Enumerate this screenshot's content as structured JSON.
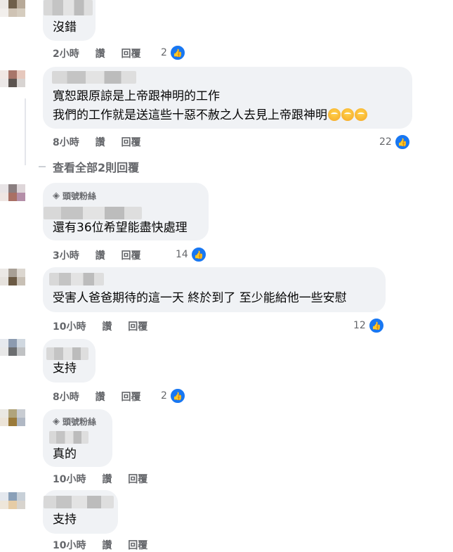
{
  "comments": [
    {
      "text": "沒錯",
      "time": "2小時",
      "like": "讚",
      "reply": "回覆",
      "reactions": "2"
    },
    {
      "text_line1": "寬恕跟原諒是上帝跟神明的工作",
      "text_line2": "我們的工作就是送這些十惡不赦之人去見上帝跟神明",
      "time": "8小時",
      "like": "讚",
      "reply": "回覆",
      "reactions": "22"
    },
    {
      "badge": "頭號粉絲",
      "text": "還有36位希望能盡快處理",
      "time": "3小時",
      "like": "讚",
      "reply": "回覆",
      "reactions": "14"
    },
    {
      "text": "受害人爸爸期待的這一天 終於到了 至少能給他一些安慰",
      "time": "10小時",
      "like": "讚",
      "reply": "回覆",
      "reactions": "12"
    },
    {
      "text": "支持",
      "time": "8小時",
      "like": "讚",
      "reply": "回覆",
      "reactions": "2"
    },
    {
      "badge": "頭號粉絲",
      "text": "真的",
      "time": "10小時",
      "like": "讚",
      "reply": "回覆"
    },
    {
      "text": "支持",
      "time": "10小時",
      "like": "讚",
      "reply": "回覆"
    }
  ],
  "view_all_replies": "查看全部2則回覆",
  "icons": {
    "like": "thumbs-up-icon",
    "fan_badge": "diamond-icon",
    "emoji": "rolling-eyes-emoji"
  },
  "colors": {
    "bubble": "#f0f2f5",
    "meta": "#65676b",
    "like_blue": "#1877f2"
  }
}
